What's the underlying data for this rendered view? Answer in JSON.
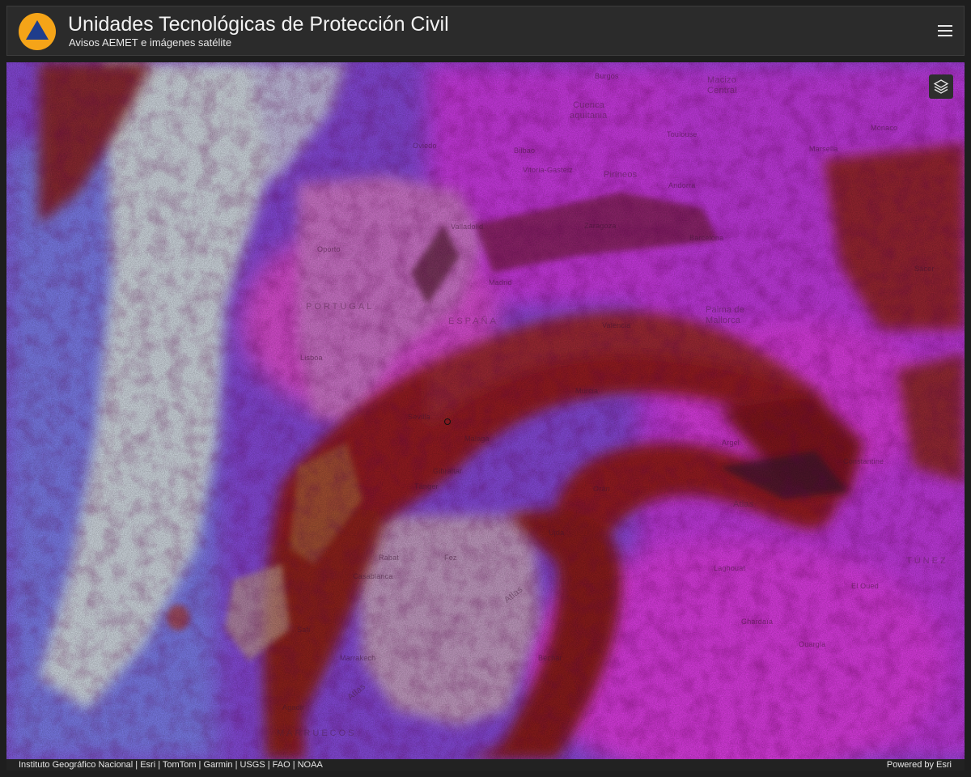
{
  "header": {
    "title": "Unidades Tecnológicas de Protección Civil",
    "subtitle": "Avisos AEMET e imágenes satélite",
    "logo_icon": "civil-protection-triangle-logo",
    "menu_icon": "hamburger-menu-icon"
  },
  "colors": {
    "header_bg": "#2b2b2b",
    "logo_orange": "#f5a418",
    "logo_blue": "#1f3d8c",
    "sat_magenta": "#e436e0",
    "sat_red": "#8f1d1d",
    "sat_lavender": "#b8a6e6"
  },
  "map": {
    "layers_icon": "layers-icon",
    "labels": {
      "burgos": "Burgos",
      "macizo": "Macizo",
      "central": "Central",
      "cuenca": "Cuenca",
      "aquitania": "aquitania",
      "toulouse": "Toulouse",
      "monaco": "Mónaco",
      "marsella": "Marsella",
      "oviedo": "Oviedo",
      "bilbao": "Bilbao",
      "vitoria": "Vitoria-Gasteiz",
      "pirineos": "Pirineos",
      "andorra": "Andorra",
      "valladolid": "Valladolid",
      "zaragoza": "Zaragoza",
      "barcelona": "Barcelona",
      "oporto": "Oporto",
      "sacer": "Sácer",
      "madrid": "Madrid",
      "portugal": "PORTUGAL",
      "espana": "ESPAÑA",
      "palma1": "Palma de",
      "palma2": "Mallorca",
      "valencia": "Valencia",
      "lisboa": "Lisboa",
      "murcia": "Murcia",
      "sevilla": "Sevilla",
      "malaga": "Málaga",
      "argel": "Argel",
      "gibraltar": "Gibraltar",
      "constantine": "Constantine",
      "tanger": "Tánger",
      "oran": "Orán",
      "atlas": "Atlas",
      "ujda": "Ujda",
      "tunez": "TÚNEZ",
      "rabat": "Rabat",
      "fez": "Fez",
      "laghouat": "Laghouat",
      "casablanca": "Casablanca",
      "elqued": "El Oued",
      "atlas2": "Atlas",
      "ghardaia": "Ghardaïa",
      "safi": "Safi",
      "ouargla": "Ouargla",
      "marrakech": "Marrakech",
      "bechar": "Béchar",
      "atlas3": "Atlas",
      "agadir": "Agadir",
      "marruecos": "MARRUECOS"
    }
  },
  "attribution": {
    "sources": "Instituto Geográfico Nacional | Esri | TomTom | Garmin | USGS | FAO | NOAA",
    "powered": "Powered by Esri"
  }
}
